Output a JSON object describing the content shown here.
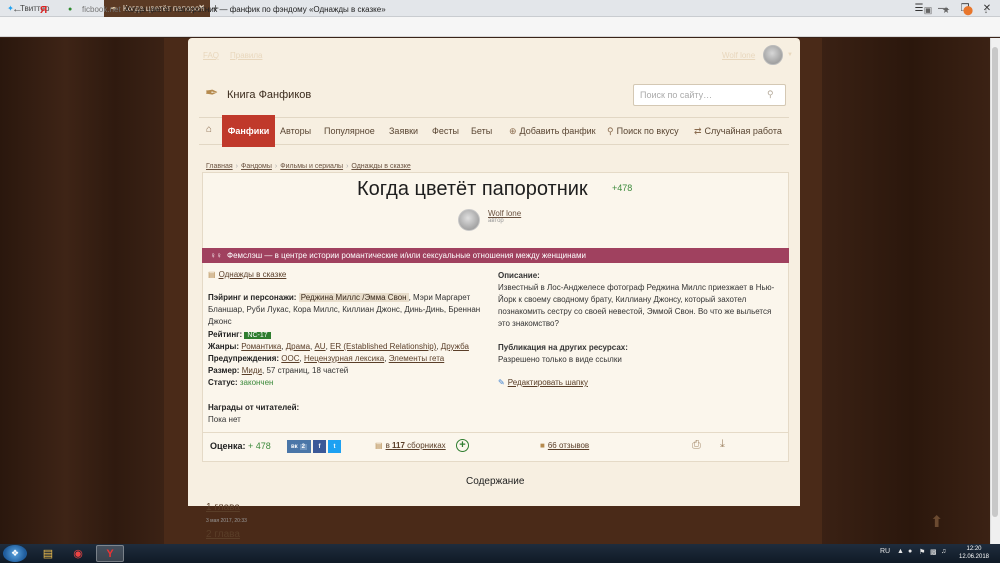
{
  "browser": {
    "tabs": [
      {
        "title": "Твиттер",
        "icon": "twitter-bird-icon"
      },
      {
        "title": "Когда цветёт папоротник",
        "icon": "feather-icon",
        "active": true
      }
    ],
    "address_host": "ficbook.net",
    "address_title": "Когда цветёт папоротник — фанфик по фэндому «Однажды в сказке»",
    "yandex_letter": "Я"
  },
  "topnav": {
    "faq": "FAQ",
    "rules": "Правила",
    "user_name": "Wolf lone"
  },
  "header": {
    "logo_text": "Книга Фанфиков",
    "search_placeholder": "Поиск по сайту…"
  },
  "menu": {
    "active": "Фанфики",
    "items": [
      "Авторы",
      "Популярное",
      "Заявки",
      "Фесты",
      "Беты"
    ],
    "add_fic": "Добавить фанфик",
    "search_by_taste": "Поиск по вкусу",
    "random": "Случайная работа"
  },
  "breadcrumbs": [
    "Главная",
    "Фандомы",
    "Фильмы и сериалы",
    "Однажды в сказке"
  ],
  "fic": {
    "title": "Когда цветёт папоротник",
    "likes": "+478",
    "author": "Wolf lone",
    "author_role": "автор",
    "direction": "Фемслэш — в центре истории романтические и/или сексуальные отношения между женщинами",
    "fandom": "Однажды в сказке",
    "pairing_label": "Пэйринг и персонажи:",
    "pairing_main": "Реджина Миллс /Эмма Свон",
    "pairing_rest": ", Мэри Маргарет Бланшар, Руби Лукас, Кора Миллс, Киллиан Джонс, Динь-Динь, Бреннан Джонс",
    "rating_label": "Рейтинг:",
    "rating": "NC-17",
    "genres_label": "Жанры:",
    "genres": [
      "Романтика",
      "Драма",
      "AU",
      "ER (Established Relationship)",
      "Дружба"
    ],
    "warnings_label": "Предупреждения:",
    "warnings": [
      "ООС",
      "Нецензурная лексика",
      "Элементы гета"
    ],
    "size_label": "Размер:",
    "size_link": "Миди",
    "size_rest": ", 57 страниц, 18 частей",
    "status_label": "Статус:",
    "status": "закончен",
    "awards_label": "Награды от читателей:",
    "awards": "Пока нет",
    "description_label": "Описание:",
    "description": "Известный в Лос-Анджелесе фотограф Реджина Миллс приезжает в Нью-Йорк к своему сводному брату, Киллиану Джонсу, который захотел познакомить сестру со своей невестой, Эммой Свон. Во что же выльется это знакомство?",
    "publication_label": "Публикация на других ресурсах:",
    "publication": "Разрешено только в виде ссылки",
    "edit_header": "Редактировать шапку"
  },
  "footer_bar": {
    "score_label": "Оценка:",
    "score": "+ 478",
    "vk_label": "вк",
    "vk_count": "2",
    "fb_label": "f",
    "tw_label": "t",
    "collections_prefix": "в ",
    "collections_count": "117",
    "collections_suffix": " сборниках",
    "reviews": "66 отзывов"
  },
  "toc": {
    "title": "Содержание",
    "chapters": [
      {
        "title": "1 глава",
        "date": "3 мая 2017, 20:33"
      },
      {
        "title": "2 глава"
      }
    ]
  },
  "taskbar": {
    "lang": "RU",
    "time": "12:20",
    "date": "12.06.2018"
  },
  "colors": {
    "accent_red": "#c0392b",
    "femslash": "#a0415f",
    "rating_green": "#2f7d2f"
  }
}
